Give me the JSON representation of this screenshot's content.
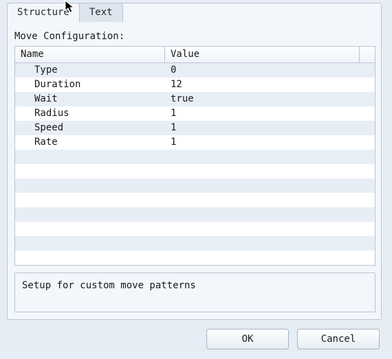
{
  "tabs": [
    {
      "label": "Structure",
      "active": true
    },
    {
      "label": "Text",
      "active": false
    }
  ],
  "section_label": "Move Configuration:",
  "columns": {
    "name": "Name",
    "value": "Value"
  },
  "rows": [
    {
      "name": "Type",
      "value": "0"
    },
    {
      "name": "Duration",
      "value": "12"
    },
    {
      "name": "Wait",
      "value": "true"
    },
    {
      "name": "Radius",
      "value": "1"
    },
    {
      "name": "Speed",
      "value": "1"
    },
    {
      "name": "Rate",
      "value": "1"
    }
  ],
  "blank_rows": 8,
  "description": "Setup for custom move patterns",
  "buttons": {
    "ok": "OK",
    "cancel": "Cancel"
  }
}
